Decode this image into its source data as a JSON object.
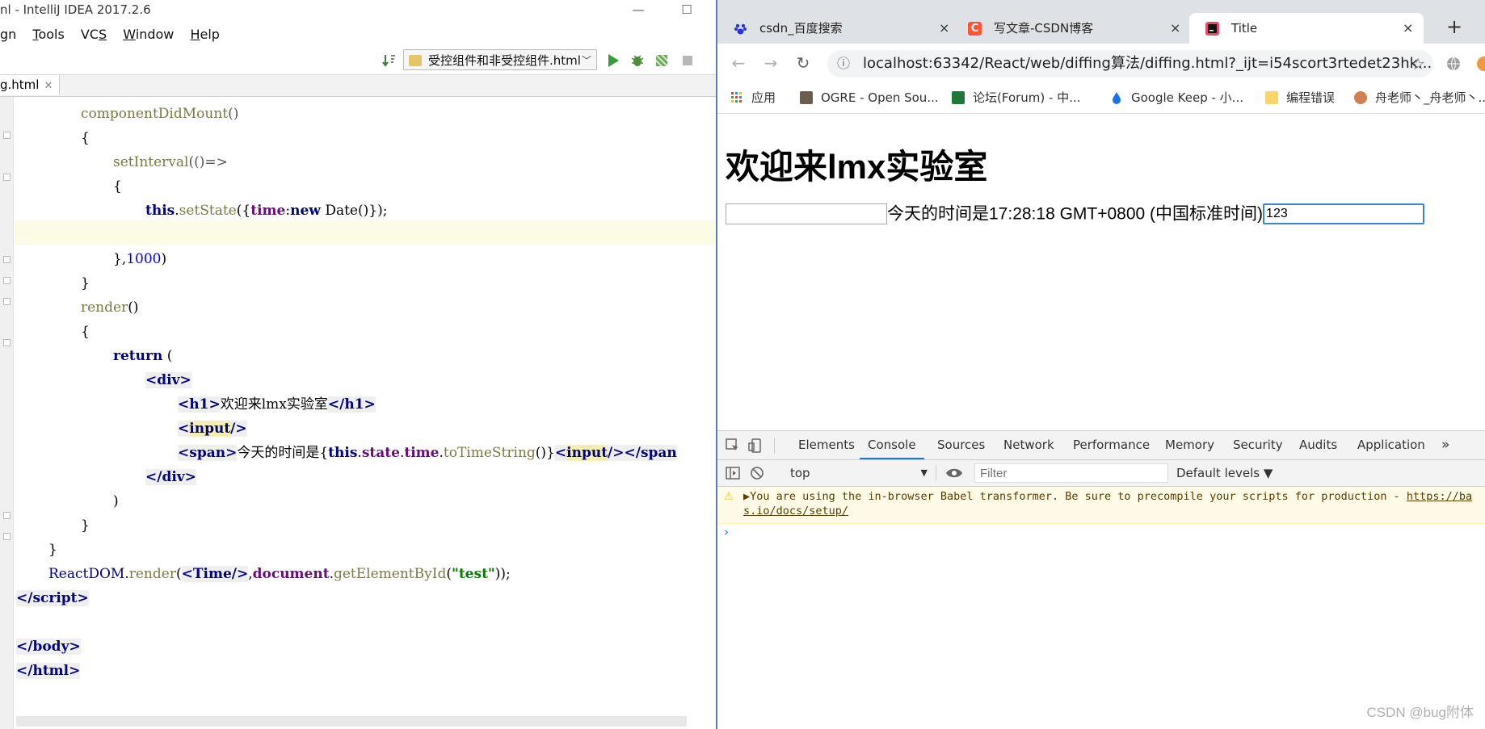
{
  "ide": {
    "window_title": "nl - IntelliJ IDEA 2017.2.6",
    "window_controls": {
      "minimize": "—",
      "maximize": "☐"
    },
    "menu": [
      {
        "label": "gn",
        "mnemonic_index": -1
      },
      {
        "label": "Tools",
        "mnemonic_index": 0
      },
      {
        "label": "VCS",
        "mnemonic_index": 2
      },
      {
        "label": "Window",
        "mnemonic_index": 0
      },
      {
        "label": "Help",
        "mnemonic_index": 0
      }
    ],
    "run_config": "受控组件和非受控组件.html",
    "file_tab": "g.html",
    "code": {
      "line1": "componentDidMount",
      "line3": "setInterval",
      "line5_this": "this",
      "line5_setState": "setState",
      "line5_time": "time",
      "line5_new": "new",
      "line5_date": "Date",
      "line7_num": "1000",
      "line9": "render",
      "line11_return": "return",
      "tag_div": "div",
      "tag_h1": "h1",
      "h1_text": "欢迎来lmx实验室",
      "tag_input": "input",
      "tag_span": "span",
      "span_text": "今天的时间是",
      "span_this": "this",
      "span_state": "state",
      "span_time": "time",
      "span_fn": "toTimeString",
      "reactdom": "ReactDOM",
      "render": "render",
      "comp": "Time",
      "document": "document",
      "getById": "getElementById",
      "test_str": "\"test\"",
      "tag_script": "script",
      "tag_body": "body",
      "tag_html": "html"
    }
  },
  "browser": {
    "tabs": [
      {
        "label": "csdn_百度搜索",
        "close": "×"
      },
      {
        "label": "写文章-CSDN博客",
        "close": "×"
      },
      {
        "label": "Title",
        "close": "×"
      }
    ],
    "new_tab": "+",
    "nav": {
      "back": "←",
      "forward": "→",
      "reload": "↻"
    },
    "url": "localhost:63342/React/web/diffing算法/diffing.html?_ijt=i54scort3rtedet23hk...",
    "bookmarks": [
      "应用",
      "OGRE - Open Sou...",
      "论坛(Forum) - 中...",
      "Google Keep - 小...",
      "编程错误",
      "舟老师丶_舟老师丶..."
    ],
    "page": {
      "heading": "欢迎来lmx实验室",
      "time_text": "今天的时间是17:28:18 GMT+0800 (中国标准时间)",
      "input1_value": "",
      "input2_value": "123"
    },
    "devtools": {
      "tabs": [
        "Elements",
        "Console",
        "Sources",
        "Network",
        "Performance",
        "Memory",
        "Security",
        "Audits",
        "Application"
      ],
      "more": "»",
      "context": "top",
      "filter_placeholder": "Filter",
      "levels": "Default levels ▼",
      "warning_line1": "▶You are using the in-browser Babel transformer. Be sure to precompile your scripts for production - ",
      "warning_link1": "https://ba",
      "warning_link2": "s.io/docs/setup/",
      "prompt": "›"
    }
  },
  "watermark": "CSDN @bug附体"
}
